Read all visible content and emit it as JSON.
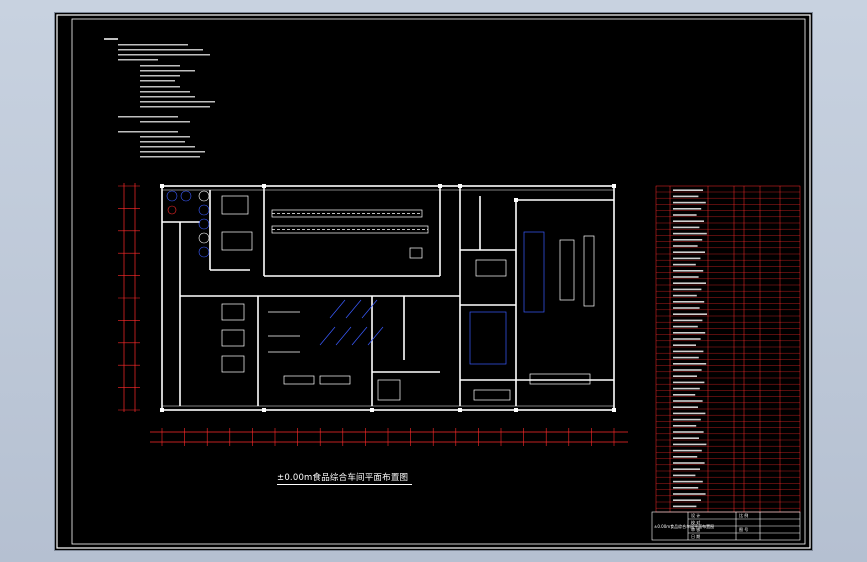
{
  "drawing": {
    "title": "±0.00m食品综合车间平面布置图",
    "colors": {
      "background": "#000000",
      "frame": "#ffffff",
      "walls": "#ffffff",
      "axis": "#ff2a2a",
      "equipment": "#ffffff",
      "legend_table": "#ff2a2a",
      "highlight_blue": "#3a5bff",
      "viewer_bg": "#bfc8d8"
    }
  },
  "title_block": {
    "drawing_name": "±0.00m食品综合车间平面布置图",
    "rows": [
      "设 计",
      "校 对",
      "审 核",
      "日 期"
    ],
    "scale_label": "比 例",
    "sheet_label": "图 号"
  }
}
